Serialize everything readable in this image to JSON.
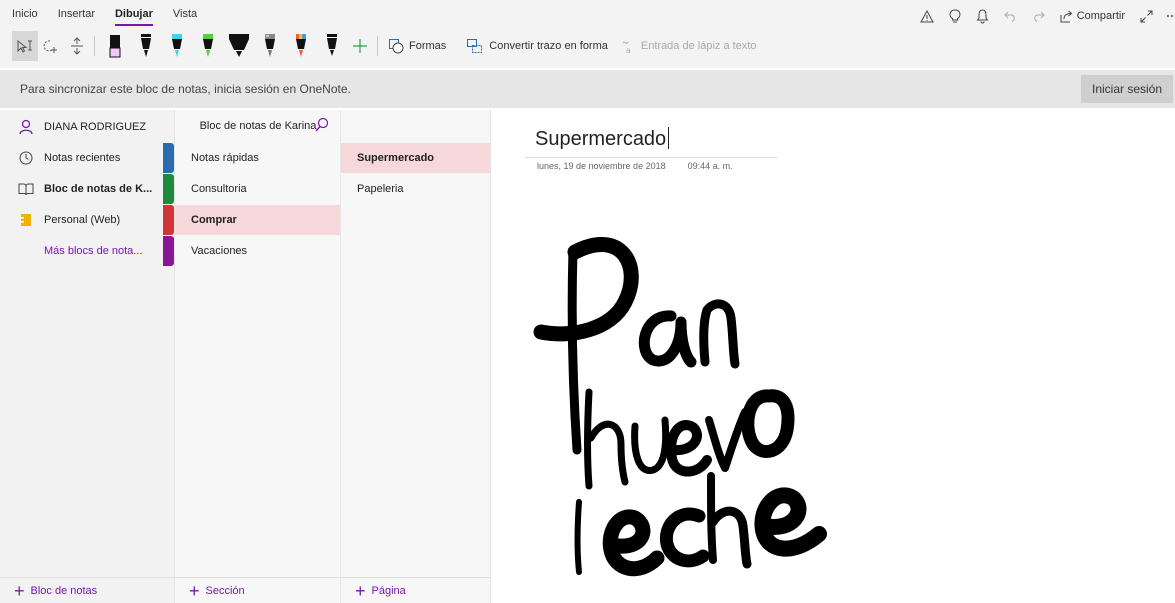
{
  "ribbon": {
    "tabs": [
      "Inicio",
      "Insertar",
      "Dibujar",
      "Vista"
    ],
    "active_tab": "Dibujar",
    "share_label": "Compartir",
    "tools": {
      "shapes_label": "Formas",
      "convert_label": "Convertir trazo en forma",
      "ink_to_text_label": "Entrada de lápiz a texto"
    },
    "pens": [
      {
        "name": "highlighter-purple",
        "color": "#f1c8ff"
      },
      {
        "name": "pen-black",
        "color": "#111111"
      },
      {
        "name": "pen-cyan",
        "color": "#3fd3f0"
      },
      {
        "name": "pen-green",
        "color": "#4cd630"
      },
      {
        "name": "pen-black-wide",
        "color": "#111111"
      },
      {
        "name": "pen-galaxy",
        "color": "#8a8a8a"
      },
      {
        "name": "pen-rainbow",
        "color": "#ff5a3c"
      },
      {
        "name": "pen-black-small",
        "color": "#111111"
      }
    ]
  },
  "signin": {
    "message": "Para sincronizar este bloc de notas, inicia sesión en OneNote.",
    "button": "Iniciar sesión"
  },
  "notebooks": {
    "user": "DIANA RODRIGUEZ",
    "items": [
      {
        "label": "Notas recientes"
      },
      {
        "label": "Bloc de notas de K..."
      },
      {
        "label": "Personal (Web)"
      }
    ],
    "more_link": "Más blocs de nota...",
    "add_label": "Bloc de notas"
  },
  "sections": {
    "header": "Bloc de notas de Karina",
    "items": [
      {
        "label": "Notas rápidas",
        "color": "#2b6cb0"
      },
      {
        "label": "Consultoria",
        "color": "#1e8a3c"
      },
      {
        "label": "Comprar",
        "color": "#d13438"
      },
      {
        "label": "Vacaciones",
        "color": "#881798"
      }
    ],
    "selected": "Comprar",
    "add_label": "Sección"
  },
  "pages": {
    "items": [
      {
        "label": "Supermercado"
      },
      {
        "label": "Papeleria"
      }
    ],
    "selected": "Supermercado",
    "add_label": "Página"
  },
  "note": {
    "title": "Supermercado",
    "date": "lunes, 19 de noviembre de 2018",
    "time": "09:44 a. m."
  },
  "colors": {
    "accent": "#7719aa",
    "selection": "#f6d7da"
  }
}
